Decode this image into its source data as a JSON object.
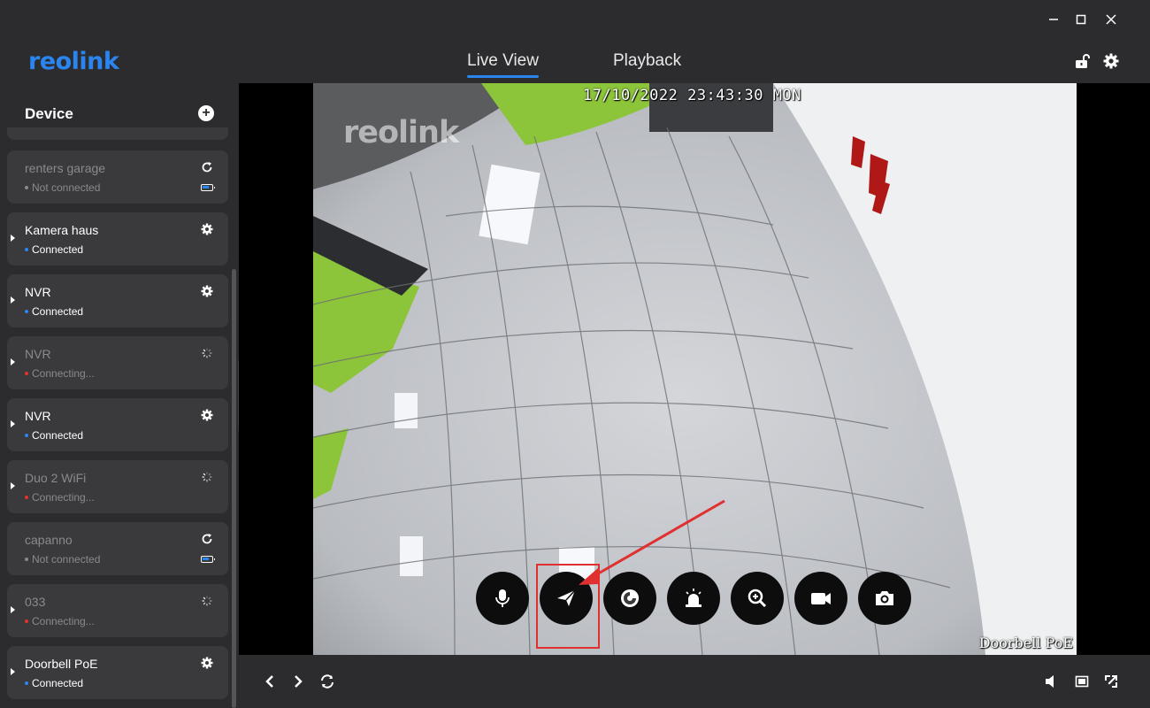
{
  "app": {
    "brand": "reolink"
  },
  "nav": {
    "tabs": [
      {
        "label": "Live View",
        "active": true
      },
      {
        "label": "Playback",
        "active": false
      }
    ]
  },
  "sidebar": {
    "title": "Device",
    "devices": [
      {
        "name": "renters garage",
        "status": "Not connected",
        "state": "offline",
        "action_icon": "refresh-icon",
        "battery": true
      },
      {
        "name": "Kamera haus",
        "status": "Connected",
        "state": "connected",
        "action_icon": "gear-icon",
        "battery": false
      },
      {
        "name": "NVR",
        "status": "Connected",
        "state": "connected",
        "action_icon": "gear-icon",
        "battery": false
      },
      {
        "name": "NVR",
        "status": "Connecting...",
        "state": "connecting",
        "action_icon": "spinner-icon",
        "battery": false
      },
      {
        "name": "NVR",
        "status": "Connected",
        "state": "connected",
        "action_icon": "gear-icon",
        "battery": false
      },
      {
        "name": "Duo 2 WiFi",
        "status": "Connecting...",
        "state": "connecting",
        "action_icon": "spinner-icon",
        "battery": false
      },
      {
        "name": "capanno",
        "status": "Not connected",
        "state": "offline",
        "action_icon": "refresh-icon",
        "battery": true
      },
      {
        "name": "033",
        "status": "Connecting...",
        "state": "connecting",
        "action_icon": "spinner-icon",
        "battery": false
      },
      {
        "name": "Doorbell PoE",
        "status": "Connected",
        "state": "connected",
        "action_icon": "gear-icon",
        "battery": false
      }
    ]
  },
  "video": {
    "timestamp": "17/10/2022 23:43:30 MON",
    "camera_label": "Doorbell PoE",
    "watermark": "reolink",
    "controls": [
      "microphone-icon",
      "quick-reply-icon",
      "siren-disc-icon",
      "alarm-light-icon",
      "zoom-icon",
      "record-icon",
      "snapshot-icon"
    ]
  },
  "colors": {
    "accent": "#2a85f0",
    "connected_dot": "#2a85f0",
    "connecting_dot": "#e03030",
    "offline_dot": "#8a8a8d",
    "highlight": "#e03030"
  }
}
